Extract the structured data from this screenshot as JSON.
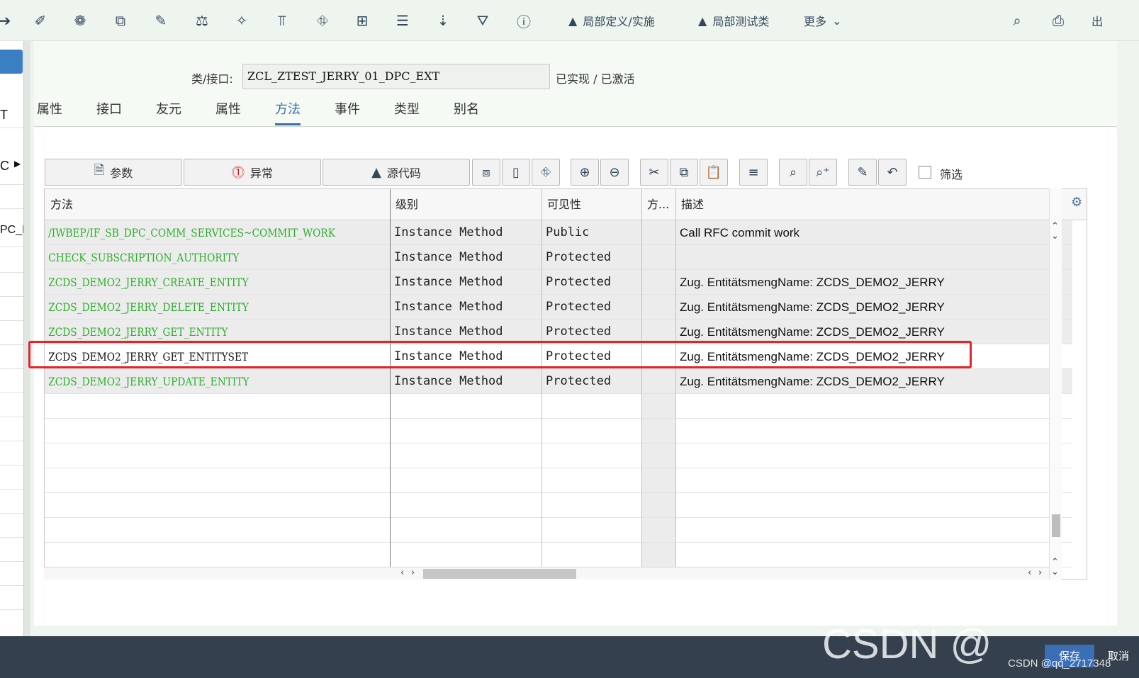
{
  "toolbar": {
    "local_def_label": "局部定义/实施",
    "local_test_label": "局部测试类",
    "more_label": "更多",
    "exit_label": "出"
  },
  "left_panel": {
    "items": [
      "T",
      "C",
      "PC_E"
    ]
  },
  "class": {
    "label": "类/接口:",
    "value": "ZCL_ZTEST_JERRY_01_DPC_EXT",
    "status": "已实现 / 已激活"
  },
  "tabs": [
    {
      "label": "属性"
    },
    {
      "label": "接口"
    },
    {
      "label": "友元"
    },
    {
      "label": "属性"
    },
    {
      "label": "方法",
      "active": true
    },
    {
      "label": "事件"
    },
    {
      "label": "类型"
    },
    {
      "label": "别名"
    }
  ],
  "method_toolbar": {
    "params_label": "参数",
    "exceptions_label": "异常",
    "source_label": "源代码",
    "filter_label": "筛选"
  },
  "table": {
    "columns": [
      "方法",
      "级别",
      "可见性",
      "方...",
      "描述"
    ],
    "rows": [
      {
        "method": "/IWBEP/IF_SB_DPC_COMM_SERVICES~COMMIT_WORK",
        "level": "Instance Method",
        "visibility": "Public",
        "desc": "Call RFC commit work"
      },
      {
        "method": "CHECK_SUBSCRIPTION_AUTHORITY",
        "level": "Instance Method",
        "visibility": "Protected",
        "desc": ""
      },
      {
        "method": "ZCDS_DEMO2_JERRY_CREATE_ENTITY",
        "level": "Instance Method",
        "visibility": "Protected",
        "desc": "Zug. EntitätsmengName:  ZCDS_DEMO2_JERRY"
      },
      {
        "method": "ZCDS_DEMO2_JERRY_DELETE_ENTITY",
        "level": "Instance Method",
        "visibility": "Protected",
        "desc": "Zug. EntitätsmengName:  ZCDS_DEMO2_JERRY"
      },
      {
        "method": "ZCDS_DEMO2_JERRY_GET_ENTITY",
        "level": "Instance Method",
        "visibility": "Protected",
        "desc": "Zug. EntitätsmengName:  ZCDS_DEMO2_JERRY"
      },
      {
        "method": "ZCDS_DEMO2_JERRY_GET_ENTITYSET",
        "level": "Instance Method",
        "visibility": "Protected",
        "desc": "Zug. EntitätsmengName:  ZCDS_DEMO2_JERRY",
        "selected": true
      },
      {
        "method": "ZCDS_DEMO2_JERRY_UPDATE_ENTITY",
        "level": "Instance Method",
        "visibility": "Protected",
        "desc": "Zug. EntitätsmengName:  ZCDS_DEMO2_JERRY"
      }
    ]
  },
  "footer": {
    "save_label": "保存",
    "cancel_label": "取消",
    "watermark": "CSDN @",
    "watermark_small": "CSDN @qq_2717348"
  },
  "colors": {
    "method_green": "#2fae2f",
    "active_tab": "#3c6ea5",
    "highlight": "#e3242b",
    "bottom_bar": "#34404d"
  }
}
